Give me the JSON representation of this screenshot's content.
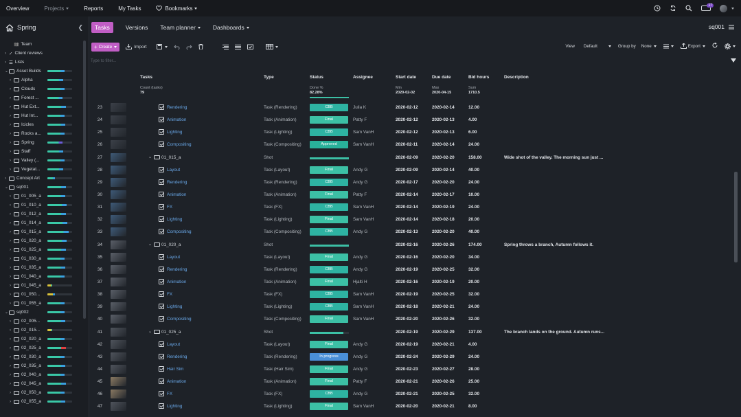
{
  "topnav": {
    "items": [
      "Overview",
      "Projects",
      "Reports",
      "My Tasks",
      "Bookmarks"
    ],
    "notif_count": "17"
  },
  "sidebar": {
    "project": "Spring",
    "tree": [
      {
        "label": "Team",
        "level": 1,
        "icon": "team",
        "bar": null
      },
      {
        "label": "Client reviews",
        "level": 0,
        "icon": "check",
        "bar": null
      },
      {
        "label": "Lists",
        "level": 0,
        "icon": "list",
        "bar": null
      },
      {
        "label": "Asset Builds",
        "level": 0,
        "icon": "folder",
        "bar": [
          70,
          "#3ac9a7",
          "#3aa0e0"
        ]
      },
      {
        "label": "Alpha",
        "level": 1,
        "icon": "folder",
        "bar": [
          65,
          "#3ac9a7",
          "#3aa0e0"
        ]
      },
      {
        "label": "Clouds",
        "level": 1,
        "icon": "folder",
        "bar": [
          70,
          "#3ac9a7",
          "#3aa0e0"
        ]
      },
      {
        "label": "Forest ...",
        "level": 1,
        "icon": "folder",
        "bar": [
          60,
          "#3ac9a7",
          "#3aa0e0"
        ]
      },
      {
        "label": "Hut Ext...",
        "level": 1,
        "icon": "folder",
        "bar": [
          75,
          "#3ac9a7",
          "#3aa0e0"
        ]
      },
      {
        "label": "Hut Int...",
        "level": 1,
        "icon": "folder",
        "bar": [
          70,
          "#3ac9a7",
          "#3aa0e0"
        ]
      },
      {
        "label": "Icicles",
        "level": 1,
        "icon": "folder",
        "bar": [
          72,
          "#3ac9a7",
          "#3aa0e0"
        ]
      },
      {
        "label": "Rocks a...",
        "level": 1,
        "icon": "folder",
        "bar": [
          70,
          "#3ac9a7",
          "#3aa0e0"
        ]
      },
      {
        "label": "Spring",
        "level": 1,
        "icon": "folder",
        "bar": [
          60,
          "#3ac9a7",
          "#6b5bd8"
        ]
      },
      {
        "label": "Staff",
        "level": 1,
        "icon": "folder",
        "bar": [
          65,
          "#3ac9a7",
          "#3aa0e0"
        ]
      },
      {
        "label": "Valley (...",
        "level": 1,
        "icon": "folder",
        "bar": [
          70,
          "#3ac9a7",
          "#3aa0e0"
        ]
      },
      {
        "label": "Vegetat...",
        "level": 1,
        "icon": "folder",
        "bar": [
          65,
          "#3ac9a7",
          "#3aa0e0"
        ]
      },
      {
        "label": "Concept Art",
        "level": 0,
        "icon": "folder",
        "bar": [
          30,
          "#3ac9a7",
          "#3aa0e0"
        ]
      },
      {
        "label": "sq001",
        "level": 0,
        "icon": "folder",
        "bar": [
          75,
          "#3ac9a7",
          "#3aa0e0"
        ]
      },
      {
        "label": "01_005_a",
        "level": 1,
        "icon": "folder",
        "bar": [
          72,
          "#3ac9a7",
          "#3aa0e0"
        ]
      },
      {
        "label": "01_010_a",
        "level": 1,
        "icon": "folder",
        "bar": [
          78,
          "#3ac9a7",
          "#3aa0e0"
        ]
      },
      {
        "label": "01_012_a",
        "level": 1,
        "icon": "folder",
        "bar": [
          75,
          "#3ac9a7",
          "#3aa0e0"
        ]
      },
      {
        "label": "01_014_a",
        "level": 1,
        "icon": "folder",
        "bar": [
          80,
          "#3ac9a7",
          "#3aa0e0"
        ]
      },
      {
        "label": "01_015_a",
        "level": 1,
        "icon": "folder",
        "bar": [
          85,
          "#3ac9a7",
          "#3aa0e0"
        ]
      },
      {
        "label": "01_020_a",
        "level": 1,
        "icon": "folder",
        "bar": [
          78,
          "#3ac9a7",
          "#3aa0e0"
        ]
      },
      {
        "label": "01_025_a",
        "level": 1,
        "icon": "folder",
        "bar": [
          75,
          "#3ac9a7",
          "#3aa0e0"
        ]
      },
      {
        "label": "01_030_a",
        "level": 1,
        "icon": "folder",
        "bar": [
          70,
          "#3ac9a7",
          "#3aa0e0"
        ]
      },
      {
        "label": "01_035_a",
        "level": 1,
        "icon": "folder",
        "bar": [
          72,
          "#3ac9a7",
          "#3aa0e0"
        ]
      },
      {
        "label": "01_040_a",
        "level": 1,
        "icon": "folder",
        "bar": [
          70,
          "#3ac9a7",
          "#3aa0e0"
        ]
      },
      {
        "label": "01_045_a",
        "level": 1,
        "icon": "folder",
        "bar": [
          20,
          "#d8c23a",
          "#3ac9a7"
        ]
      },
      {
        "label": "01_050...",
        "level": 1,
        "icon": "folder",
        "bar": [
          30,
          "#d8c23a",
          "#3aa0e0"
        ]
      },
      {
        "label": "01_055_a",
        "level": 1,
        "icon": "folder",
        "bar": [
          70,
          "#3ac9a7",
          "#3aa0e0"
        ]
      },
      {
        "label": "sq002",
        "level": 0,
        "icon": "folder",
        "bar": [
          70,
          "#3ac9a7",
          "#3aa0e0"
        ]
      },
      {
        "label": "02_005...",
        "level": 1,
        "icon": "folder",
        "bar": [
          72,
          "#3ac9a7",
          "#3aa0e0"
        ]
      },
      {
        "label": "02_015...",
        "level": 1,
        "icon": "folder",
        "bar": [
          20,
          "#d8c23a",
          "#3ac9a7"
        ]
      },
      {
        "label": "02_020_a",
        "level": 1,
        "icon": "folder",
        "bar": [
          70,
          "#3ac9a7",
          "#3aa0e0"
        ]
      },
      {
        "label": "02_025_a",
        "level": 1,
        "icon": "folder",
        "bar": [
          75,
          "#3ac9a7",
          "#e04040"
        ]
      },
      {
        "label": "02_030_a",
        "level": 1,
        "icon": "folder",
        "bar": [
          70,
          "#3ac9a7",
          "#3aa0e0"
        ]
      },
      {
        "label": "02_035_a",
        "level": 1,
        "icon": "folder",
        "bar": [
          72,
          "#3ac9a7",
          "#3aa0e0"
        ]
      },
      {
        "label": "02_040_a",
        "level": 1,
        "icon": "folder",
        "bar": [
          70,
          "#3ac9a7",
          "#3aa0e0"
        ]
      },
      {
        "label": "02_045_a",
        "level": 1,
        "icon": "folder",
        "bar": [
          74,
          "#3ac9a7",
          "#3aa0e0"
        ]
      },
      {
        "label": "02_050_a",
        "level": 1,
        "icon": "folder",
        "bar": [
          70,
          "#3ac9a7",
          "#3aa0e0"
        ]
      },
      {
        "label": "02_055_a",
        "level": 1,
        "icon": "folder",
        "bar": [
          72,
          "#3ac9a7",
          "#3aa0e0"
        ]
      }
    ]
  },
  "header": {
    "tabs": [
      "Tasks",
      "Versions",
      "Team planner",
      "Dashboards"
    ],
    "project_code": "sq001"
  },
  "toolbar": {
    "create": "Create",
    "import": "Import",
    "view_label": "View",
    "view_value": "Default",
    "group_label": "Group by",
    "group_value": "None",
    "export": "Export",
    "filter_placeholder": "Type to filter..."
  },
  "columns": {
    "tasks": "Tasks",
    "type": "Type",
    "status": "Status",
    "assignee": "Assignee",
    "start": "Start date",
    "due": "Due date",
    "bid": "Bid hours",
    "desc": "Description"
  },
  "aggregates": {
    "count_label": "Count (tasks)",
    "count": "79",
    "done_label": "Done %",
    "done": "82.28%",
    "min_label": "Min",
    "min": "2020-02-02",
    "max_label": "Max",
    "max": "2020-04-15",
    "sum_label": "Sum",
    "sum": "1710.5"
  },
  "status_colors": {
    "CBB": "#2eb3a2",
    "Final": "#3cc0a5",
    "Approved": "#29b19a",
    "In progress": "#4a8fd8"
  },
  "rows": [
    {
      "n": "23",
      "kind": "task",
      "name": "Rendering",
      "type": "Task (Rendering)",
      "status": "CBB",
      "assignee": "Julia K",
      "start": "2020-02-12",
      "due": "2020-02-14",
      "bid": "12.00",
      "desc": "",
      "thumb": "#3b4048"
    },
    {
      "n": "24",
      "kind": "task",
      "name": "Animation",
      "type": "Task (Animation)",
      "status": "Final",
      "assignee": "Patty F",
      "start": "2020-02-12",
      "due": "2020-02-13",
      "bid": "4.00",
      "desc": "",
      "thumb": "#3b4048"
    },
    {
      "n": "25",
      "kind": "task",
      "name": "Lighting",
      "type": "Task (Lighting)",
      "status": "CBB",
      "assignee": "Sam VanH",
      "start": "2020-02-12",
      "due": "2020-02-13",
      "bid": "6.00",
      "desc": "",
      "thumb": "#3b4048"
    },
    {
      "n": "26",
      "kind": "task",
      "name": "Compositing",
      "type": "Task (Compositing)",
      "status": "Approved",
      "assignee": "Sam VanH",
      "start": "2020-02-11",
      "due": "2020-02-14",
      "bid": "24.00",
      "desc": "",
      "thumb": "#3b4048"
    },
    {
      "n": "27",
      "kind": "shot",
      "name": "01_015_a",
      "type": "Shot",
      "status": "",
      "progress": 1.0,
      "assignee": "",
      "start": "2020-02-09",
      "due": "2020-02-20",
      "bid": "158.00",
      "desc": "Wide shot of the valley. The morning sun just ...",
      "thumb": "#3e5a78"
    },
    {
      "n": "28",
      "kind": "task",
      "name": "Layout",
      "type": "Task (Layout)",
      "status": "Final",
      "assignee": "Andy G",
      "start": "2020-02-09",
      "due": "2020-02-14",
      "bid": "40.00",
      "desc": "",
      "thumb": "#3e5a78"
    },
    {
      "n": "29",
      "kind": "task",
      "name": "Rendering",
      "type": "Task (Rendering)",
      "status": "CBB",
      "assignee": "Andy G",
      "start": "2020-02-17",
      "due": "2020-02-20",
      "bid": "24.00",
      "desc": "",
      "thumb": "#3e5a78"
    },
    {
      "n": "30",
      "kind": "task",
      "name": "Animation",
      "type": "Task (Animation)",
      "status": "Final",
      "assignee": "Patty F",
      "start": "2020-02-14",
      "due": "2020-02-17",
      "bid": "10.00",
      "desc": "",
      "thumb": "#3e5a78"
    },
    {
      "n": "31",
      "kind": "task",
      "name": "FX",
      "type": "Task (FX)",
      "status": "CBB",
      "assignee": "Sam VanH",
      "start": "2020-02-14",
      "due": "2020-02-19",
      "bid": "24.00",
      "desc": "",
      "thumb": "#3e5a78"
    },
    {
      "n": "32",
      "kind": "task",
      "name": "Lighting",
      "type": "Task (Lighting)",
      "status": "Final",
      "assignee": "Sam VanH",
      "start": "2020-02-14",
      "due": "2020-02-18",
      "bid": "20.00",
      "desc": "",
      "thumb": "#3e5a78"
    },
    {
      "n": "33",
      "kind": "task",
      "name": "Compositing",
      "type": "Task (Compositing)",
      "status": "CBB",
      "assignee": "Andy G",
      "start": "2020-02-13",
      "due": "2020-02-20",
      "bid": "40.00",
      "desc": "",
      "thumb": "#3e5a78"
    },
    {
      "n": "34",
      "kind": "shot",
      "name": "01_020_a",
      "type": "Shot",
      "status": "",
      "progress": 1.0,
      "assignee": "",
      "start": "2020-02-16",
      "due": "2020-02-26",
      "bid": "174.00",
      "desc": "Spring throws a branch, Autumn follows it.",
      "thumb": "#5a5f68"
    },
    {
      "n": "35",
      "kind": "task",
      "name": "Layout",
      "type": "Task (Layout)",
      "status": "Final",
      "assignee": "Andy G",
      "start": "2020-02-16",
      "due": "2020-02-20",
      "bid": "34.00",
      "desc": "",
      "thumb": "#5a5f68"
    },
    {
      "n": "36",
      "kind": "task",
      "name": "Rendering",
      "type": "Task (Rendering)",
      "status": "CBB",
      "assignee": "Andy G",
      "start": "2020-02-19",
      "due": "2020-02-25",
      "bid": "32.00",
      "desc": "",
      "thumb": "#5a5f68"
    },
    {
      "n": "37",
      "kind": "task",
      "name": "Animation",
      "type": "Task (Animation)",
      "status": "Final",
      "assignee": "Hjalti H",
      "start": "2020-02-16",
      "due": "2020-02-19",
      "bid": "20.00",
      "desc": "",
      "thumb": "#5a5f68"
    },
    {
      "n": "38",
      "kind": "task",
      "name": "FX",
      "type": "Task (FX)",
      "status": "CBB",
      "assignee": "Sam VanH",
      "start": "2020-02-19",
      "due": "2020-02-25",
      "bid": "32.00",
      "desc": "",
      "thumb": "#5a5f68"
    },
    {
      "n": "39",
      "kind": "task",
      "name": "Lighting",
      "type": "Task (Lighting)",
      "status": "CBB",
      "assignee": "Sam VanH",
      "start": "2020-02-18",
      "due": "2020-02-21",
      "bid": "24.00",
      "desc": "",
      "thumb": "#5a5f68"
    },
    {
      "n": "40",
      "kind": "task",
      "name": "Compositing",
      "type": "Task (Compositing)",
      "status": "Final",
      "assignee": "Sam VanH",
      "start": "2020-02-20",
      "due": "2020-02-26",
      "bid": "32.00",
      "desc": "",
      "thumb": "#5a5f68"
    },
    {
      "n": "41",
      "kind": "shot",
      "name": "01_025_a",
      "type": "Shot",
      "status": "",
      "progress": 0.86,
      "assignee": "",
      "start": "2020-02-19",
      "due": "2020-02-29",
      "bid": "137.00",
      "desc": "The branch lands on the ground. Autumn runs...",
      "thumb": "#4f545c"
    },
    {
      "n": "42",
      "kind": "task",
      "name": "Layout",
      "type": "Task (Layout)",
      "status": "Final",
      "assignee": "Andy G",
      "start": "2020-02-19",
      "due": "2020-02-21",
      "bid": "4.00",
      "desc": "",
      "thumb": "#4f545c"
    },
    {
      "n": "43",
      "kind": "task",
      "name": "Rendering",
      "type": "Task (Rendering)",
      "status": "In progress",
      "assignee": "Andy G",
      "start": "2020-02-24",
      "due": "2020-02-29",
      "bid": "24.00",
      "desc": "",
      "thumb": "#4f545c"
    },
    {
      "n": "44",
      "kind": "task",
      "name": "Hair Sim",
      "type": "Task (Hair Sim)",
      "status": "Final",
      "assignee": "Andy G",
      "start": "2020-02-23",
      "due": "2020-02-27",
      "bid": "28.00",
      "desc": "",
      "thumb": "#4f545c"
    },
    {
      "n": "45",
      "kind": "task",
      "name": "Animation",
      "type": "Task (Animation)",
      "status": "Final",
      "assignee": "Patty F",
      "start": "2020-02-21",
      "due": "2020-02-26",
      "bid": "25.00",
      "desc": "",
      "thumb": "#8a7a62"
    },
    {
      "n": "46",
      "kind": "task",
      "name": "FX",
      "type": "Task (FX)",
      "status": "CBB",
      "assignee": "Andy G",
      "start": "2020-02-21",
      "due": "2020-02-25",
      "bid": "32.00",
      "desc": "",
      "thumb": "#8a7a62"
    },
    {
      "n": "47",
      "kind": "task",
      "name": "Lighting",
      "type": "Task (Lighting)",
      "status": "Final",
      "assignee": "Sam VanH",
      "start": "2020-02-20",
      "due": "2020-02-21",
      "bid": "8.00",
      "desc": "",
      "thumb": "#4f545c"
    }
  ]
}
